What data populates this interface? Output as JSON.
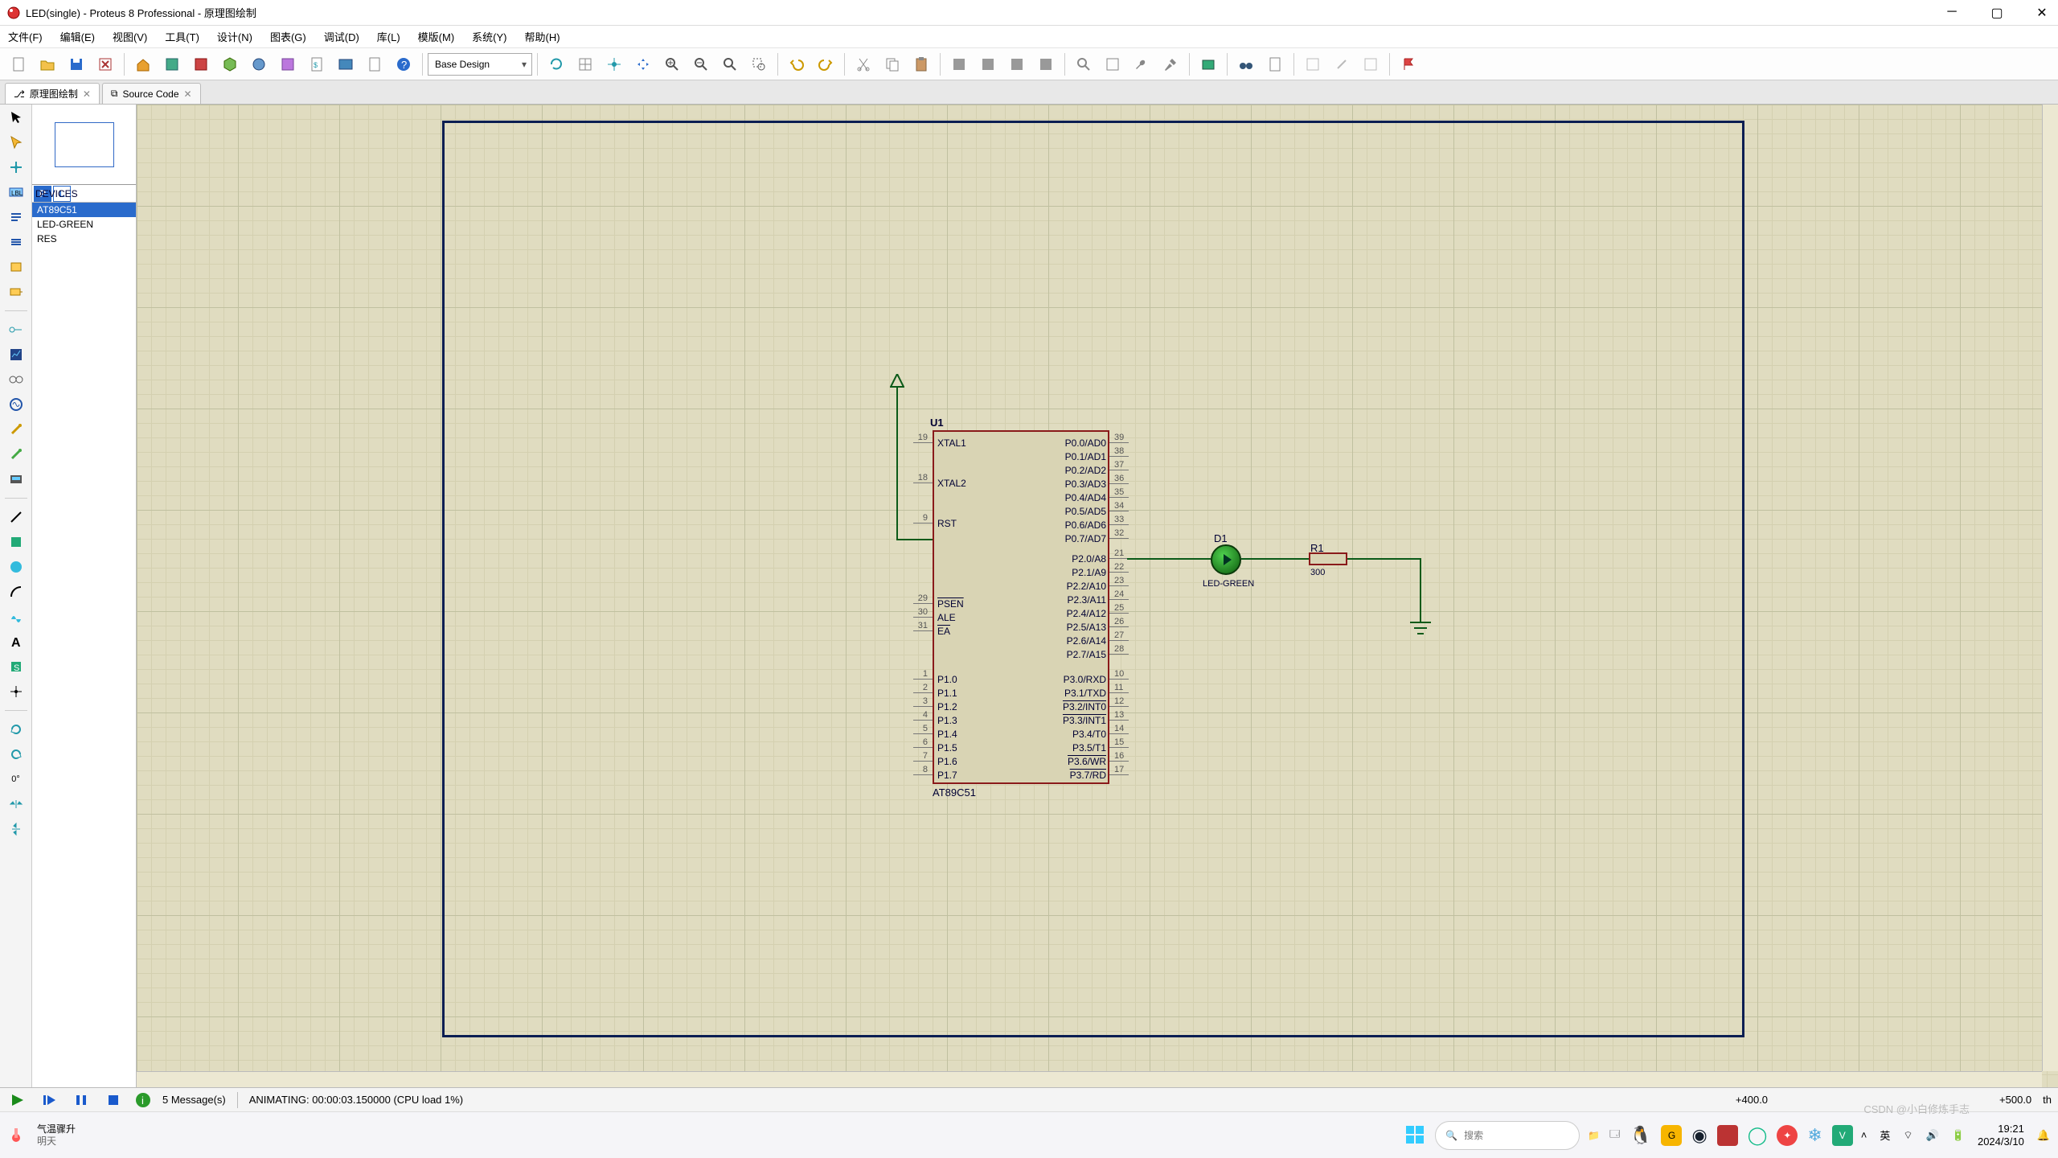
{
  "title": "LED(single) - Proteus 8 Professional - 原理图绘制",
  "menu": [
    "文件(F)",
    "编辑(E)",
    "视图(V)",
    "工具(T)",
    "设计(N)",
    "图表(G)",
    "调试(D)",
    "库(L)",
    "模版(M)",
    "系统(Y)",
    "帮助(H)"
  ],
  "combo": "Base Design",
  "tabs": [
    {
      "label": "原理图绘制",
      "active": true
    },
    {
      "label": "Source Code",
      "active": false
    }
  ],
  "device_header": "DEVICES",
  "devices": [
    {
      "name": "AT89C51",
      "sel": true
    },
    {
      "name": "LED-GREEN",
      "sel": false
    },
    {
      "name": "RES",
      "sel": false
    }
  ],
  "schematic": {
    "chip_ref": "U1",
    "chip_part": "AT89C51",
    "left_pins_a": [
      {
        "n": "19",
        "l": "XTAL1"
      },
      {
        "n": "18",
        "l": "XTAL2"
      },
      {
        "n": "9",
        "l": "RST"
      }
    ],
    "left_pins_b": [
      {
        "n": "29",
        "l": "PSEN",
        "ov": true
      },
      {
        "n": "30",
        "l": "ALE"
      },
      {
        "n": "31",
        "l": "EA",
        "ov": true
      }
    ],
    "left_pins_c": [
      {
        "n": "1",
        "l": "P1.0"
      },
      {
        "n": "2",
        "l": "P1.1"
      },
      {
        "n": "3",
        "l": "P1.2"
      },
      {
        "n": "4",
        "l": "P1.3"
      },
      {
        "n": "5",
        "l": "P1.4"
      },
      {
        "n": "6",
        "l": "P1.5"
      },
      {
        "n": "7",
        "l": "P1.6"
      },
      {
        "n": "8",
        "l": "P1.7"
      }
    ],
    "right_pins_a": [
      {
        "n": "39",
        "l": "P0.0/AD0"
      },
      {
        "n": "38",
        "l": "P0.1/AD1"
      },
      {
        "n": "37",
        "l": "P0.2/AD2"
      },
      {
        "n": "36",
        "l": "P0.3/AD3"
      },
      {
        "n": "35",
        "l": "P0.4/AD4"
      },
      {
        "n": "34",
        "l": "P0.5/AD5"
      },
      {
        "n": "33",
        "l": "P0.6/AD6"
      },
      {
        "n": "32",
        "l": "P0.7/AD7"
      }
    ],
    "right_pins_b": [
      {
        "n": "21",
        "l": "P2.0/A8"
      },
      {
        "n": "22",
        "l": "P2.1/A9"
      },
      {
        "n": "23",
        "l": "P2.2/A10"
      },
      {
        "n": "24",
        "l": "P2.3/A11"
      },
      {
        "n": "25",
        "l": "P2.4/A12"
      },
      {
        "n": "26",
        "l": "P2.5/A13"
      },
      {
        "n": "27",
        "l": "P2.6/A14"
      },
      {
        "n": "28",
        "l": "P2.7/A15"
      }
    ],
    "right_pins_c": [
      {
        "n": "10",
        "l": "P3.0/RXD"
      },
      {
        "n": "11",
        "l": "P3.1/TXD"
      },
      {
        "n": "12",
        "l": "P3.2/INT0",
        "ov": true
      },
      {
        "n": "13",
        "l": "P3.3/INT1",
        "ov": true
      },
      {
        "n": "14",
        "l": "P3.4/T0"
      },
      {
        "n": "15",
        "l": "P3.5/T1"
      },
      {
        "n": "16",
        "l": "P3.6/WR",
        "ov": true
      },
      {
        "n": "17",
        "l": "P3.7/RD",
        "ov": true
      }
    ],
    "led_ref": "D1",
    "led_part": "LED-GREEN",
    "res_ref": "R1",
    "res_val": "300"
  },
  "status": {
    "messages": "5 Message(s)",
    "anim": "ANIMATING: 00:00:03.150000 (CPU load 1%)",
    "coord_x": "+400.0",
    "coord_y": "+500.0",
    "unit": "th"
  },
  "taskbar": {
    "weather1": "气温骤升",
    "weather2": "明天",
    "search": "搜索",
    "ime": "英",
    "time": "19:21",
    "date": "2024/3/10",
    "watermark": "CSDN @小白修炼手志"
  }
}
